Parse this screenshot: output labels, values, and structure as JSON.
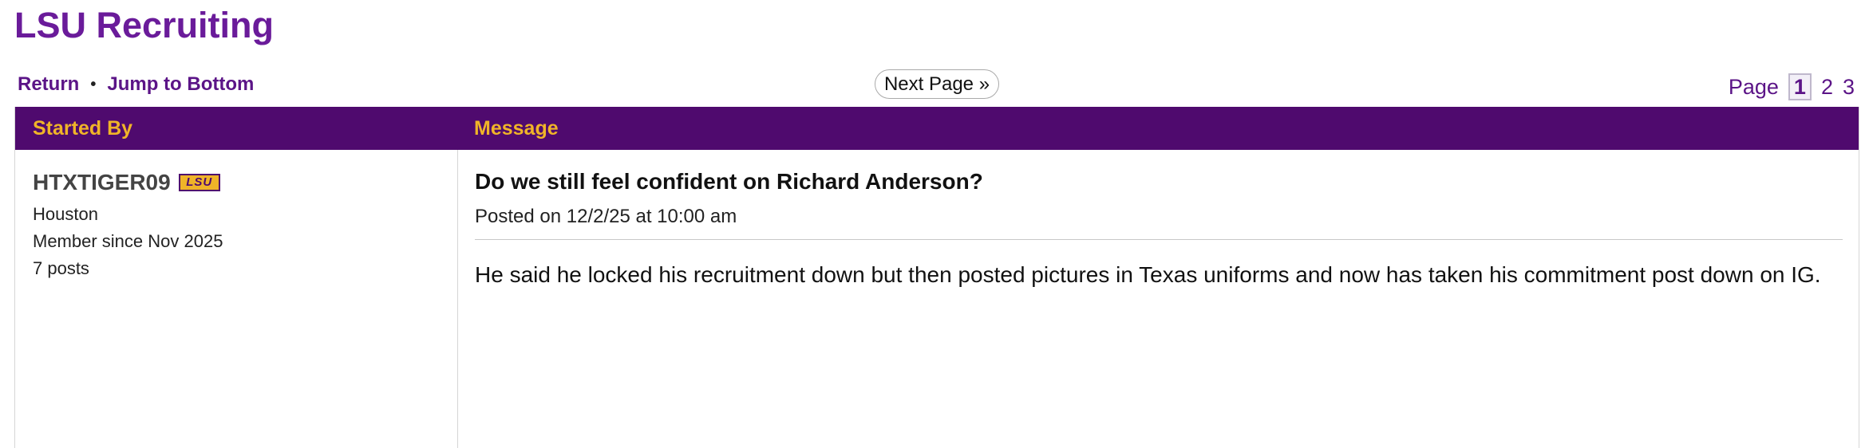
{
  "board": {
    "title": "LSU Recruiting"
  },
  "nav": {
    "return_label": "Return",
    "separator": "•",
    "jump_label": "Jump to Bottom",
    "next_page_label": "Next Page »"
  },
  "pager": {
    "label": "Page",
    "pages": [
      "1",
      "2",
      "3"
    ],
    "current": "1"
  },
  "table": {
    "headers": {
      "started_by": "Started By",
      "message": "Message"
    }
  },
  "author": {
    "name": "HTXTIGER09",
    "badge": "LSU",
    "location": "Houston",
    "member_since": "Member since Nov 2025",
    "posts": "7 posts"
  },
  "post": {
    "title": "Do we still feel confident on Richard Anderson?",
    "posted": "Posted on 12/2/25 at 10:00 am",
    "body": "He said he locked his recruitment down but then posted pictures in Texas uniforms and now has taken his commitment post down on IG."
  },
  "colors": {
    "brand_purple": "#6a1b9a",
    "header_purple": "#4f0a6e",
    "gold": "#f0b428"
  }
}
